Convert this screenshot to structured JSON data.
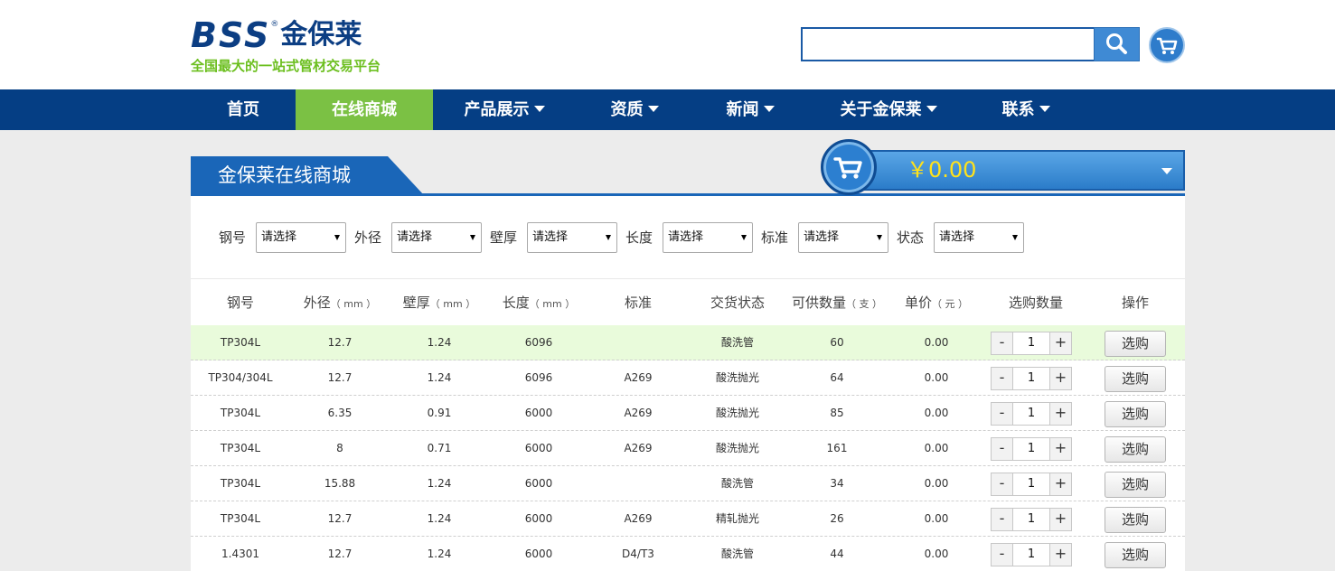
{
  "header": {
    "logo_latin": "BSS",
    "logo_reg": "®",
    "logo_cn": "金保莱",
    "slogan": "全国最大的一站式管材交易平台",
    "search_value": "",
    "search_icon": "search-icon",
    "cart_icon": "cart-icon"
  },
  "nav": {
    "items": [
      {
        "label": "首页",
        "dropdown": false,
        "active": false
      },
      {
        "label": "在线商城",
        "dropdown": false,
        "active": true
      },
      {
        "label": "产品展示",
        "dropdown": true,
        "active": false
      },
      {
        "label": "资质",
        "dropdown": true,
        "active": false
      },
      {
        "label": "新闻",
        "dropdown": true,
        "active": false
      },
      {
        "label": "关于金保莱",
        "dropdown": true,
        "active": false
      },
      {
        "label": "联系",
        "dropdown": true,
        "active": false
      }
    ]
  },
  "section": {
    "title": "金保莱在线商城",
    "cart_total": "￥0.00"
  },
  "filters": [
    {
      "label": "钢号",
      "value": "请选择"
    },
    {
      "label": "外径",
      "value": "请选择"
    },
    {
      "label": "壁厚",
      "value": "请选择"
    },
    {
      "label": "长度",
      "value": "请选择"
    },
    {
      "label": "标准",
      "value": "请选择"
    },
    {
      "label": "状态",
      "value": "请选择"
    }
  ],
  "table": {
    "headers": [
      {
        "label": "钢号",
        "unit": ""
      },
      {
        "label": "外径",
        "unit": "（ mm ）"
      },
      {
        "label": "壁厚",
        "unit": "（ mm ）"
      },
      {
        "label": "长度",
        "unit": "（ mm ）"
      },
      {
        "label": "标准",
        "unit": ""
      },
      {
        "label": "交货状态",
        "unit": ""
      },
      {
        "label": "可供数量",
        "unit": "（ 支 ）"
      },
      {
        "label": "单价",
        "unit": "（ 元 ）"
      },
      {
        "label": "选购数量",
        "unit": ""
      },
      {
        "label": "操作",
        "unit": ""
      }
    ],
    "buy_label": "选购",
    "minus_label": "-",
    "plus_label": "+",
    "rows": [
      {
        "grade": "TP304L",
        "od": "12.7",
        "wt": "1.24",
        "length": "6096",
        "standard": "",
        "state": "酸洗管",
        "qty": "60",
        "price": "0.00",
        "count": "1",
        "highlight": true
      },
      {
        "grade": "TP304/304L",
        "od": "12.7",
        "wt": "1.24",
        "length": "6096",
        "standard": "A269",
        "state": "酸洗抛光",
        "qty": "64",
        "price": "0.00",
        "count": "1",
        "highlight": false
      },
      {
        "grade": "TP304L",
        "od": "6.35",
        "wt": "0.91",
        "length": "6000",
        "standard": "A269",
        "state": "酸洗抛光",
        "qty": "85",
        "price": "0.00",
        "count": "1",
        "highlight": false
      },
      {
        "grade": "TP304L",
        "od": "8",
        "wt": "0.71",
        "length": "6000",
        "standard": "A269",
        "state": "酸洗抛光",
        "qty": "161",
        "price": "0.00",
        "count": "1",
        "highlight": false
      },
      {
        "grade": "TP304L",
        "od": "15.88",
        "wt": "1.24",
        "length": "6000",
        "standard": "",
        "state": "酸洗管",
        "qty": "34",
        "price": "0.00",
        "count": "1",
        "highlight": false
      },
      {
        "grade": "TP304L",
        "od": "12.7",
        "wt": "1.24",
        "length": "6000",
        "standard": "A269",
        "state": "精轧抛光",
        "qty": "26",
        "price": "0.00",
        "count": "1",
        "highlight": false
      },
      {
        "grade": "1.4301",
        "od": "12.7",
        "wt": "1.24",
        "length": "6000",
        "standard": "D4/T3",
        "state": "酸洗管",
        "qty": "44",
        "price": "0.00",
        "count": "1",
        "highlight": false
      }
    ]
  },
  "colors": {
    "brand_blue": "#053e84",
    "accent_green": "#7bc144",
    "row_highlight": "#e9fbdb",
    "price_yellow": "#ffe21b"
  }
}
